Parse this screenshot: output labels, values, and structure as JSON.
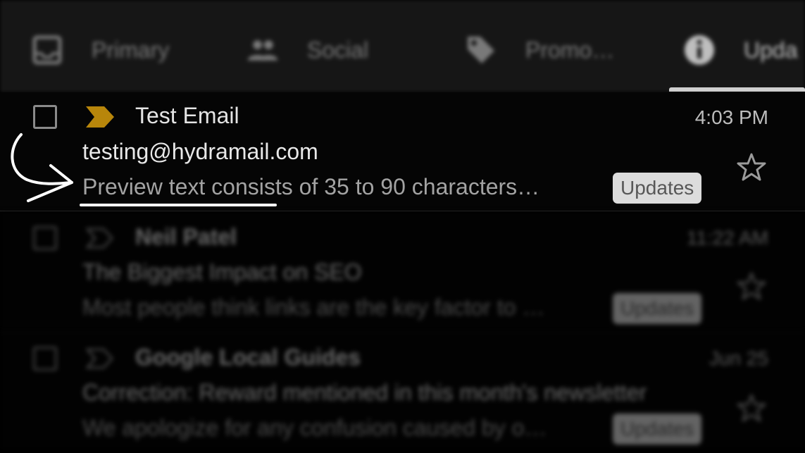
{
  "tabs": [
    {
      "label": "Primary",
      "icon": "inbox-icon"
    },
    {
      "label": "Social",
      "icon": "people-icon"
    },
    {
      "label": "Promo…",
      "icon": "tag-icon"
    },
    {
      "label": "Upda",
      "icon": "info-icon",
      "selected": true
    }
  ],
  "emails": [
    {
      "sender": "Test Email",
      "time": "4:03 PM",
      "subject": "testing@hydramail.com",
      "preview": "Preview text consists of 35 to 90 characters…",
      "label": "Updates",
      "important": true
    },
    {
      "sender": "Neil Patel",
      "time": "11:22 AM",
      "subject": "The Biggest Impact on SEO",
      "preview": "Most people think links are the key factor to …",
      "label": "Updates",
      "important": false
    },
    {
      "sender": "Google Local Guides",
      "time": "Jun 25",
      "subject": "Correction: Reward mentioned in this month's newsletter",
      "preview": "We apologize for any confusion caused by o…",
      "label": "Updates",
      "important": false
    }
  ],
  "colors": {
    "importance_marker": "#b8860b",
    "background": "#000000",
    "annotation": "#ffffff"
  }
}
